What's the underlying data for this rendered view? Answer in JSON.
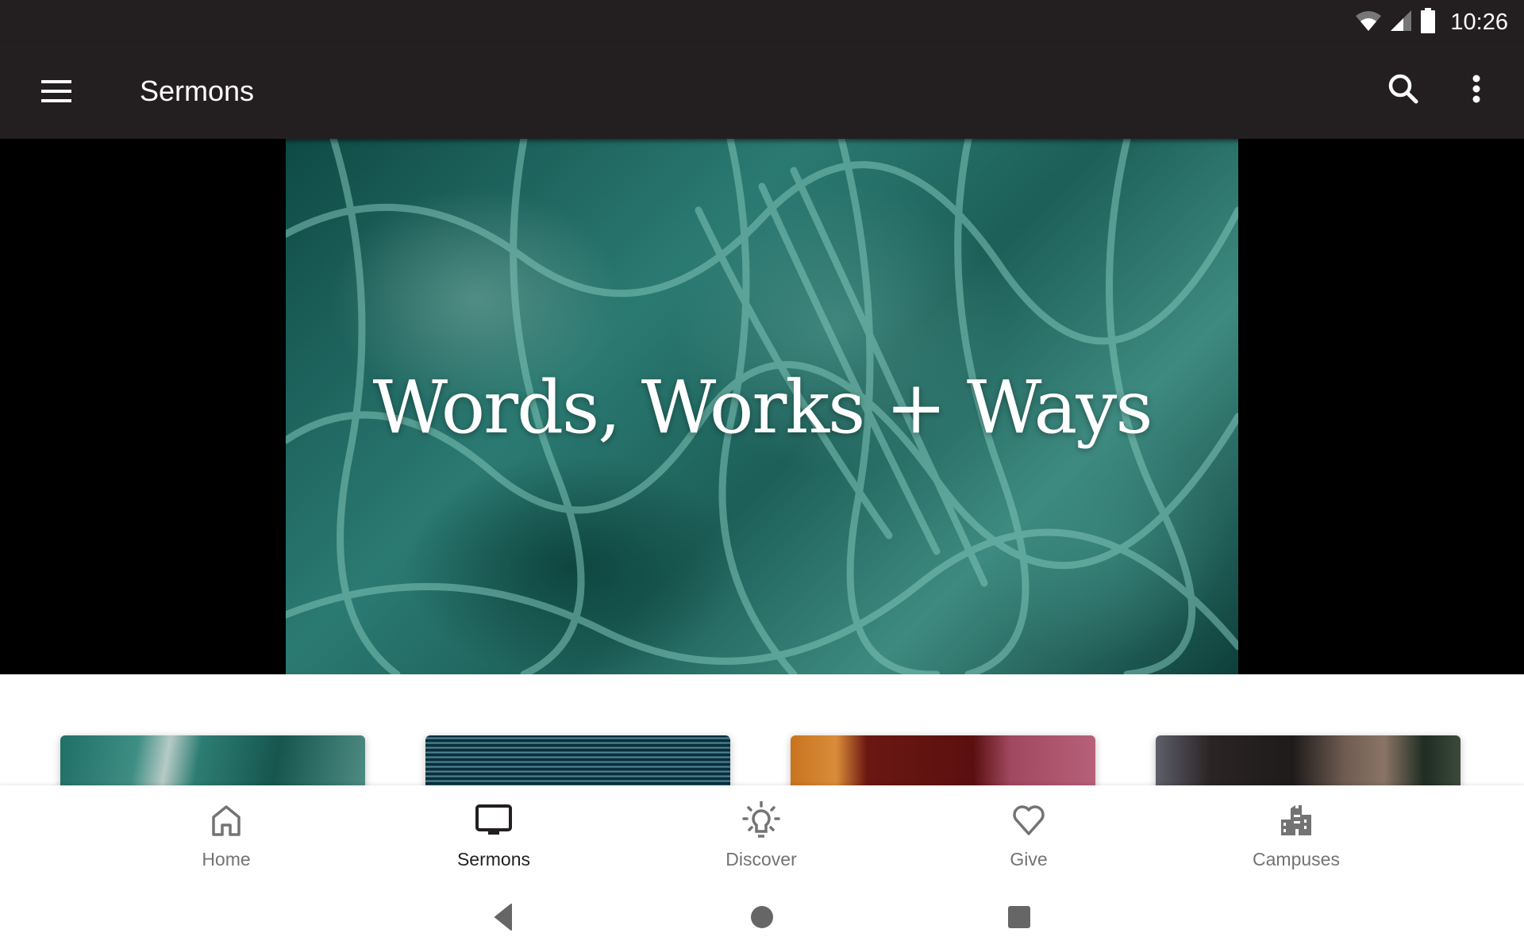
{
  "status_bar": {
    "time": "10:26",
    "icons": [
      "wifi-icon",
      "cell-signal-icon",
      "battery-icon"
    ]
  },
  "app_bar": {
    "title": "Sermons",
    "left_icon": "menu-icon",
    "right_icons": [
      "search-icon",
      "more-vert-icon"
    ]
  },
  "hero": {
    "title": "Words, Works + Ways"
  },
  "cards": [
    {
      "theme": "teal rope net"
    },
    {
      "theme": "blue digital static"
    },
    {
      "theme": "orange and red fabric"
    },
    {
      "theme": "person portrait"
    }
  ],
  "bottom_nav": {
    "items": [
      {
        "label": "Home",
        "icon": "home-icon",
        "active": false
      },
      {
        "label": "Sermons",
        "icon": "tv-icon",
        "active": true
      },
      {
        "label": "Discover",
        "icon": "lightbulb-icon",
        "active": false
      },
      {
        "label": "Give",
        "icon": "heart-icon",
        "active": false
      },
      {
        "label": "Campuses",
        "icon": "building-icon",
        "active": false
      }
    ],
    "active_color": "#231f20",
    "inactive_color": "#737373"
  },
  "system_nav": [
    "back-icon",
    "home-circle-icon",
    "recents-icon"
  ]
}
